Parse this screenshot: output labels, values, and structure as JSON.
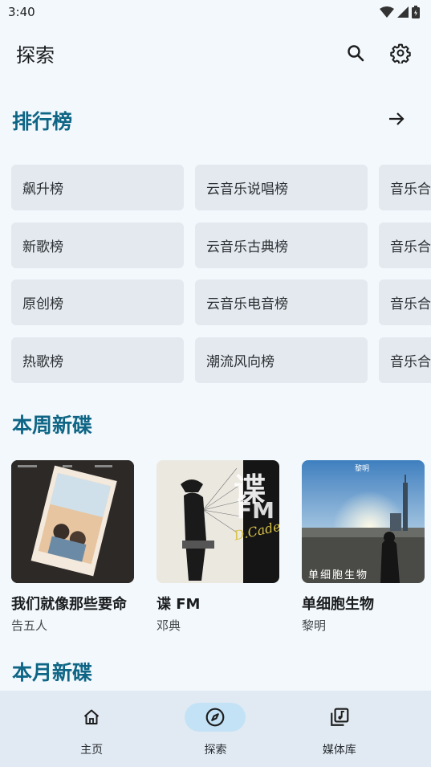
{
  "status_bar": {
    "time": "3:40"
  },
  "app_bar": {
    "title": "探索"
  },
  "charts_section": {
    "title": "排行榜",
    "rows": [
      [
        "飙升榜",
        "云音乐说唱榜",
        "音乐合"
      ],
      [
        "新歌榜",
        "云音乐古典榜",
        "音乐合"
      ],
      [
        "原创榜",
        "云音乐电音榜",
        "音乐合"
      ],
      [
        "热歌榜",
        "潮流风向榜",
        "音乐合"
      ]
    ]
  },
  "weekly_section": {
    "title": "本周新碟",
    "albums": [
      {
        "title": "我们就像那些要命",
        "artist": "告五人"
      },
      {
        "title": "谍 FM",
        "artist": "邓典",
        "cover_text": "谍",
        "cover_sub": "FM",
        "cover_script": "D.Cadet"
      },
      {
        "title": "单细胞生物",
        "artist": "黎明",
        "cover_text": "单细胞生物",
        "cover_top": "黎明"
      }
    ]
  },
  "monthly_section": {
    "title": "本月新碟"
  },
  "bottom_nav": {
    "items": [
      {
        "label": "主页",
        "icon": "home-icon"
      },
      {
        "label": "探索",
        "icon": "compass-icon",
        "active": true
      },
      {
        "label": "媒体库",
        "icon": "library-music-icon"
      }
    ]
  },
  "colors": {
    "accent": "#0e6585",
    "background": "#f2f8fc",
    "nav_active": "#c4e2f6"
  }
}
